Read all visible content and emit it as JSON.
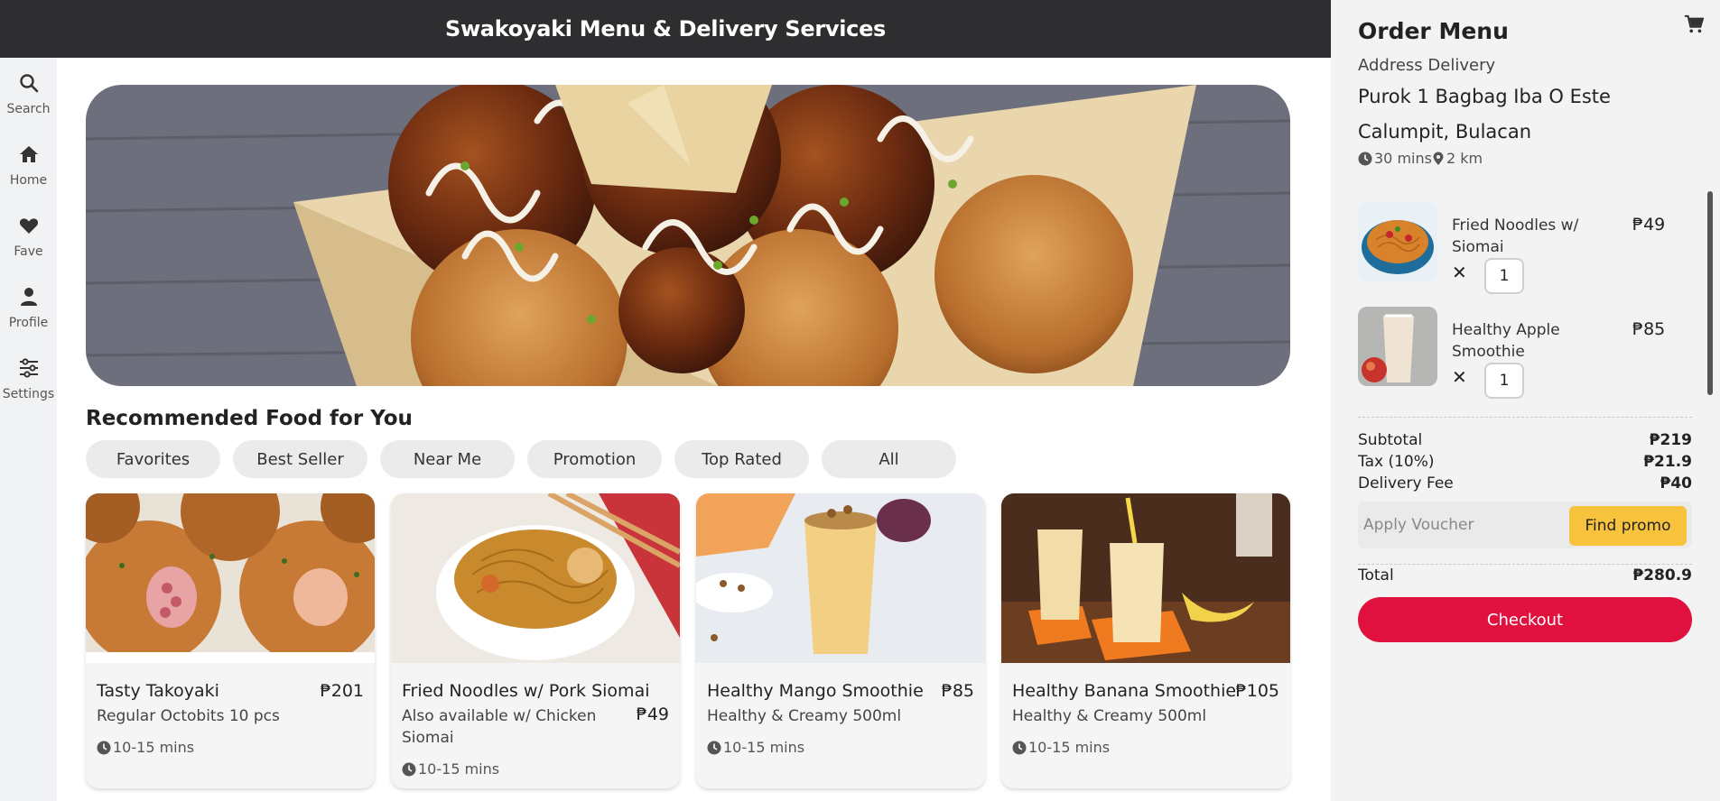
{
  "header": {
    "title": "Swakoyaki Menu & Delivery Services"
  },
  "rail": {
    "items": [
      {
        "label": "Search",
        "icon": "search-icon"
      },
      {
        "label": "Home",
        "icon": "home-icon"
      },
      {
        "label": "Fave",
        "icon": "heart-icon"
      },
      {
        "label": "Profile",
        "icon": "user-icon"
      },
      {
        "label": "Settings",
        "icon": "sliders-icon"
      }
    ]
  },
  "main": {
    "hero_icon": "takoyaki-banner-image",
    "section_title": "Recommended Food for You",
    "chips": [
      "Favorites",
      "Best Seller",
      "Near Me",
      "Promotion",
      "Top Rated",
      "All"
    ],
    "cards": [
      {
        "name": "Tasty Takoyaki",
        "price": "₱201",
        "desc": "Regular Octobits 10 pcs",
        "time": "10-15 mins"
      },
      {
        "name": "Fried Noodles w/ Pork Siomai",
        "price": "₱49",
        "desc": "Also available w/ Chicken Siomai",
        "time": "10-15 mins"
      },
      {
        "name": "Healthy Mango Smoothie",
        "price": "₱85",
        "desc": "Healthy & Creamy 500ml",
        "time": "10-15 mins"
      },
      {
        "name": "Healthy Banana Smoothie",
        "price": "₱105",
        "desc": "Healthy & Creamy 500ml",
        "time": "10-15 mins"
      }
    ]
  },
  "order": {
    "title": "Order Menu",
    "cart_icon": "cart-icon",
    "address_label": "Address Delivery",
    "address": "Purok 1 Bagbag Iba O Este Calumpit, Bulacan",
    "eta": "30 mins",
    "distance": "2 km",
    "items": [
      {
        "name": "Fried Noodles w/ Siomai",
        "price": "₱49",
        "qty": "1"
      },
      {
        "name": "Healthy Apple Smoothie",
        "price": "₱85",
        "qty": "1"
      }
    ],
    "remove_symbol": "✕",
    "subtotal_label": "Subtotal",
    "subtotal": "₱219",
    "tax_label": "Tax (10%)",
    "tax": "₱21.9",
    "delivery_label": "Delivery Fee",
    "delivery": "₱40",
    "voucher_placeholder": "Apply Voucher",
    "find_promo": "Find promo",
    "total_label": "Total",
    "total": "₱280.9",
    "checkout": "Checkout"
  },
  "colors": {
    "header_bg": "#2e2e30",
    "checkout": "#e0103f",
    "promo": "#f7c33d",
    "panel_bg": "#f3f3f4"
  }
}
